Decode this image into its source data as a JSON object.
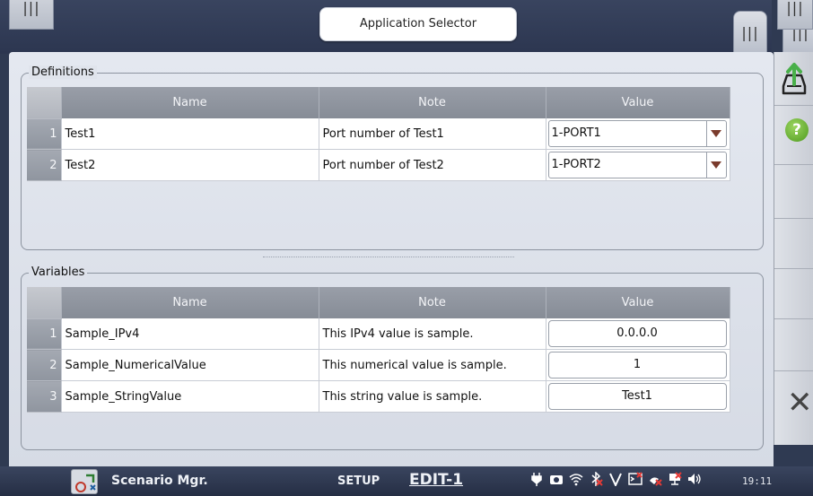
{
  "header": {
    "title": "Application Selector"
  },
  "definitions": {
    "title": "Definitions",
    "columns": [
      "Name",
      "Note",
      "Value"
    ],
    "rows": [
      {
        "num": "1",
        "name": "Test1",
        "note": "Port number of Test1",
        "value": "1-PORT1"
      },
      {
        "num": "2",
        "name": "Test2",
        "note": "Port number of Test2",
        "value": "1-PORT2"
      }
    ]
  },
  "variables": {
    "title": "Variables",
    "columns": [
      "Name",
      "Note",
      "Value"
    ],
    "rows": [
      {
        "num": "1",
        "name": "Sample_IPv4",
        "note": "This IPv4 value is sample.",
        "value": "0.0.0.0"
      },
      {
        "num": "2",
        "name": "Sample_NumericalValue",
        "note": "This numerical value is sample.",
        "value": "1"
      },
      {
        "num": "3",
        "name": "Sample_StringValue",
        "note": "This string value is sample.",
        "value": "Test1"
      }
    ]
  },
  "statusbar": {
    "app_label": "Scenario Mgr.",
    "mode_setup": "SETUP",
    "mode_edit": "EDIT-1",
    "clock": "19:11",
    "icons": [
      "plug-icon",
      "camera-icon",
      "wifi-icon",
      "bluetooth-icon",
      "v-icon",
      "terminal-icon",
      "satellite-icon",
      "network-icon",
      "speaker-icon"
    ]
  },
  "handles": {
    "glyph": "|||"
  },
  "colors": {
    "header_bg": "#2f3a52",
    "panel_bg": "#dde1ea",
    "table_header": "#8f959f",
    "dropdown_arrow": "#7a3b2c",
    "help_green": "#5aa826"
  }
}
